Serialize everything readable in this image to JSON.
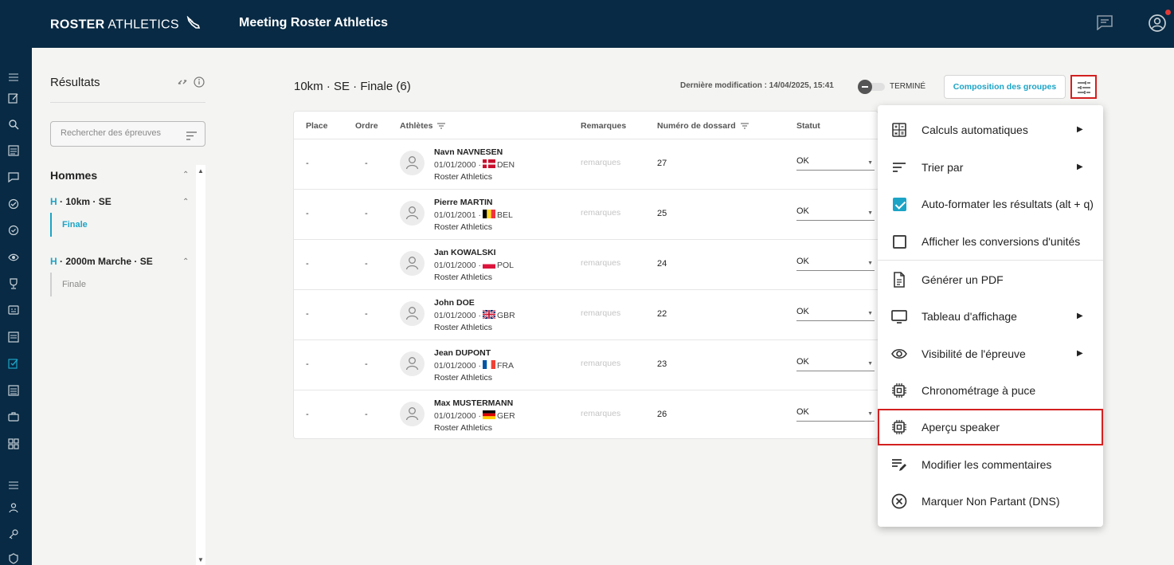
{
  "header": {
    "logo_bold": "ROSTER",
    "logo_light": "ATHLETICS",
    "meeting_title": "Meeting Roster Athletics"
  },
  "results_panel": {
    "title": "Résultats",
    "search_placeholder": "Rechercher des épreuves",
    "group_label": "Hommes",
    "events": [
      {
        "sex": "H",
        "name": "· 10km · SE",
        "phase": "Finale",
        "active": true
      },
      {
        "sex": "H",
        "name": "· 2000m Marche · SE",
        "phase": "Finale",
        "active": false
      }
    ]
  },
  "main": {
    "event_heading": "10km · SE · Finale (6)",
    "last_modified": "Dernière modification : 14/04/2025, 15:41",
    "status_toggle_label": "TERMINÉ",
    "composition_button": "Composition des groupes"
  },
  "table": {
    "columns": [
      "Place",
      "Ordre",
      "Athlètes",
      "Remarques",
      "Numéro de dossard",
      "Statut"
    ],
    "rows": [
      {
        "place": "-",
        "ordre": "-",
        "name": "Navn NAVNESEN",
        "dob": "01/01/2000 ·",
        "country": "DEN",
        "club": "Roster Athletics",
        "remark": "remarques",
        "bib": "27",
        "status": "OK"
      },
      {
        "place": "-",
        "ordre": "-",
        "name": "Pierre MARTIN",
        "dob": "01/01/2001 ·",
        "country": "BEL",
        "club": "Roster Athletics",
        "remark": "remarques",
        "bib": "25",
        "status": "OK"
      },
      {
        "place": "-",
        "ordre": "-",
        "name": "Jan KOWALSKI",
        "dob": "01/01/2000 ·",
        "country": "POL",
        "club": "Roster Athletics",
        "remark": "remarques",
        "bib": "24",
        "status": "OK"
      },
      {
        "place": "-",
        "ordre": "-",
        "name": "John DOE",
        "dob": "01/01/2000 ·",
        "country": "GBR",
        "club": "Roster Athletics",
        "remark": "remarques",
        "bib": "22",
        "status": "OK"
      },
      {
        "place": "-",
        "ordre": "-",
        "name": "Jean DUPONT",
        "dob": "01/01/2000 ·",
        "country": "FRA",
        "club": "Roster Athletics",
        "remark": "remarques",
        "bib": "23",
        "status": "OK"
      },
      {
        "place": "-",
        "ordre": "-",
        "name": "Max MUSTERMANN",
        "dob": "01/01/2000 ·",
        "country": "GER",
        "club": "Roster Athletics",
        "remark": "remarques",
        "bib": "26",
        "status": "OK"
      }
    ]
  },
  "menu": {
    "items": [
      {
        "label": "Calculs automatiques",
        "icon": "calculator-icon",
        "submenu": true
      },
      {
        "label": "Trier par",
        "icon": "sort-icon",
        "submenu": true
      },
      {
        "label": "Auto-formater les résultats (alt + q)",
        "icon": "checkbox-checked",
        "checked": true
      },
      {
        "label": "Afficher les conversions d'unités",
        "icon": "checkbox-unchecked",
        "checked": false
      },
      {
        "label": "Générer un PDF",
        "icon": "pdf-file-icon"
      },
      {
        "label": "Tableau d'affichage",
        "icon": "monitor-icon",
        "submenu": true
      },
      {
        "label": "Visibilité de l'épreuve",
        "icon": "eye-icon",
        "submenu": true
      },
      {
        "label": "Chronométrage à puce",
        "icon": "chip-icon"
      },
      {
        "label": "Aperçu speaker",
        "icon": "chip-icon",
        "highlighted": true
      },
      {
        "label": "Modifier les commentaires",
        "icon": "edit-notes-icon"
      },
      {
        "label": "Marquer Non Partant (DNS)",
        "icon": "cancel-circle-icon"
      }
    ]
  },
  "colors": {
    "navy": "#082a44",
    "accent": "#1ca4c6",
    "highlight": "#d32020"
  }
}
